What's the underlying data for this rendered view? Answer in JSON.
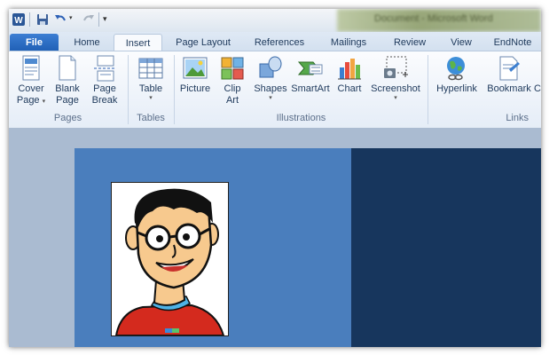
{
  "tabs": {
    "file": "File",
    "home": "Home",
    "insert": "Insert",
    "page_layout": "Page Layout",
    "references": "References",
    "mailings": "Mailings",
    "review": "Review",
    "view": "View",
    "endnote": "EndNote"
  },
  "title_fragment": "Document - Microsoft Word",
  "pages_group": {
    "label": "Pages",
    "cover_page": [
      "Cover",
      "Page"
    ],
    "blank_page": [
      "Blank",
      "Page"
    ],
    "page_break": [
      "Page",
      "Break"
    ]
  },
  "tables_group": {
    "label": "Tables",
    "table": "Table"
  },
  "illustrations_group": {
    "label": "Illustrations",
    "picture": "Picture",
    "clip_art": [
      "Clip",
      "Art"
    ],
    "shapes": "Shapes",
    "smartart": "SmartArt",
    "chart": "Chart",
    "screenshot": "Screenshot"
  },
  "links_group": {
    "label": "Links",
    "hyperlink": "Hyperlink",
    "bookmark": "Bookmark",
    "cross_ref_partial": "Cr"
  },
  "icons": [
    "word-app-icon",
    "save-icon",
    "undo-icon",
    "redo-icon",
    "customize-qat-icon",
    "cover-page-icon",
    "blank-page-icon",
    "page-break-icon",
    "table-icon",
    "picture-icon",
    "clip-art-icon",
    "shapes-icon",
    "smartart-icon",
    "chart-icon",
    "screenshot-icon",
    "hyperlink-icon",
    "bookmark-icon"
  ],
  "colors": {
    "file_tab": "#2a6bc4",
    "page_left": "#4a7ebd",
    "page_right": "#17365d"
  }
}
